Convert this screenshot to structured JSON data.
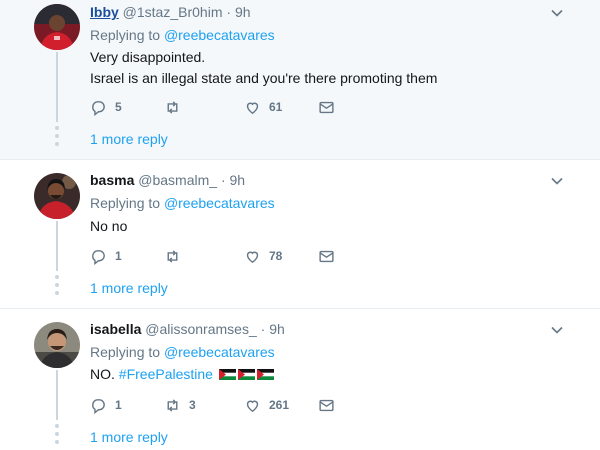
{
  "colors": {
    "link": "#1da1f2",
    "muted": "#657786",
    "highlight_bg": "#f5f8fa"
  },
  "tweets": [
    {
      "name": "Ibby",
      "handle": "@1staz_Br0him",
      "sep": "·",
      "time": "9h",
      "replying_prefix": "Replying to",
      "replying_to": "@reebecatavares",
      "text_lines": [
        "Very disappointed.",
        "Israel is an illegal state and you're there promoting them"
      ],
      "reply_count": "5",
      "retweet_count": "",
      "like_count": "61",
      "more_label": "1 more reply",
      "avatar_icon": "user-avatar-red-jersey"
    },
    {
      "name": "basma",
      "handle": "@basmalm_",
      "sep": "·",
      "time": "9h",
      "replying_prefix": "Replying to",
      "replying_to": "@reebecatavares",
      "text_lines": [
        "No no"
      ],
      "reply_count": "1",
      "retweet_count": "",
      "like_count": "78",
      "more_label": "1 more reply",
      "avatar_icon": "user-avatar-red-jersey"
    },
    {
      "name": "isabella",
      "handle": "@alissonramses_",
      "sep": "·",
      "time": "9h",
      "replying_prefix": "Replying to",
      "replying_to": "@reebecatavares",
      "text_prefix": "NO.",
      "hashtag": "#FreePalestine",
      "emoji_icons": [
        "palestine-flag-icon",
        "palestine-flag-icon",
        "palestine-flag-icon"
      ],
      "reply_count": "1",
      "retweet_count": "3",
      "like_count": "261",
      "more_label": "1 more reply",
      "avatar_icon": "user-avatar-photo"
    }
  ]
}
